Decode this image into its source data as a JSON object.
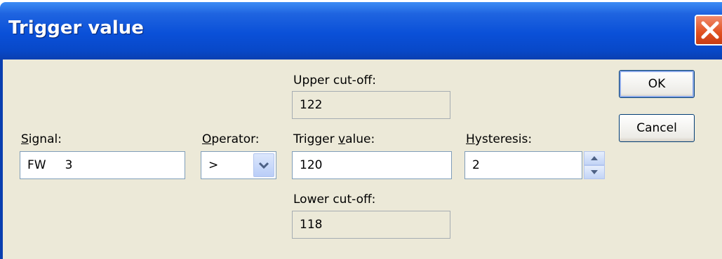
{
  "window": {
    "title": "Trigger value"
  },
  "signal": {
    "label_pre": "",
    "label_key": "S",
    "label_post": "ignal:",
    "value": "FW     3"
  },
  "operator": {
    "label_pre": "",
    "label_key": "O",
    "label_post": "perator:",
    "selected": ">"
  },
  "upper_cutoff": {
    "label": "Upper cut-off:",
    "value": "122"
  },
  "trigger": {
    "label_pre": "Trigger ",
    "label_key": "v",
    "label_post": "alue:",
    "value": "120"
  },
  "lower_cutoff": {
    "label": "Lower cut-off:",
    "value": "118"
  },
  "hysteresis": {
    "label_pre": "",
    "label_key": "H",
    "label_post": "ysteresis:",
    "value": "2"
  },
  "buttons": {
    "ok": "OK",
    "cancel": "Cancel"
  },
  "icons": {
    "close": "close-icon",
    "dropdown": "chevron-down-icon",
    "spin_up": "spin-up-icon",
    "spin_down": "spin-down-icon"
  },
  "colors": {
    "titlebar": "#0a50d8",
    "client": "#ece9d8",
    "close": "#e0501f"
  }
}
